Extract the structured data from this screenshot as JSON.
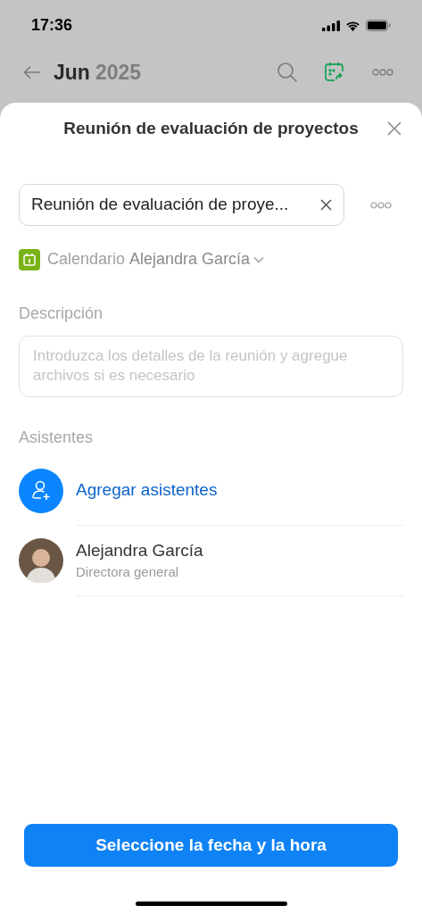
{
  "status_bar": {
    "time": "17:36"
  },
  "background_header": {
    "month": "Jun",
    "year": "2025"
  },
  "sheet": {
    "title": "Reunión de evaluación de proyectos",
    "name_field": {
      "value": "Reunión de evaluación de proye..."
    },
    "calendar": {
      "label": "Calendario",
      "owner": "Alejandra García"
    },
    "description": {
      "label": "Descripción",
      "placeholder": "Introduzca los detalles de la reunión y agregue archivos si es necesario"
    },
    "attendees": {
      "label": "Asistentes",
      "add_label": "Agregar asistentes",
      "people": [
        {
          "name": "Alejandra García",
          "role": "Directora general"
        }
      ]
    },
    "primary_button": "Seleccione la fecha y la hora"
  }
}
